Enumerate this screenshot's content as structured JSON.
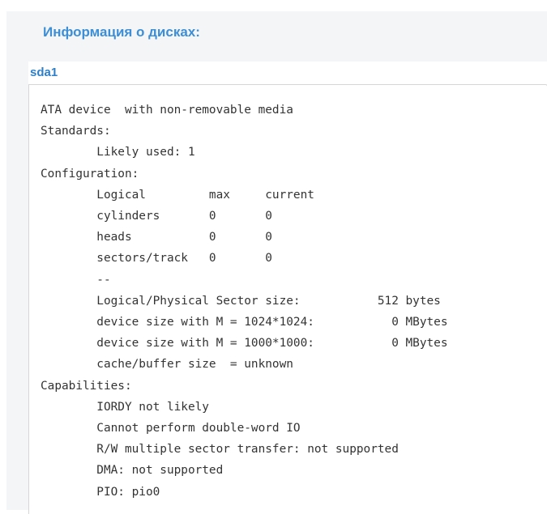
{
  "section": {
    "title": "Информация о дисках:"
  },
  "disks": [
    {
      "name": "sda1",
      "info_lines": [
        "ATA device  with non-removable media",
        "Standards:",
        "        Likely used: 1",
        "Configuration:",
        "        Logical         max     current",
        "        cylinders       0       0",
        "        heads           0       0",
        "        sectors/track   0       0",
        "        --",
        "        Logical/Physical Sector size:           512 bytes",
        "        device size with M = 1024*1024:           0 MBytes",
        "        device size with M = 1000*1000:           0 MBytes",
        "        cache/buffer size  = unknown",
        "Capabilities:",
        "        IORDY not likely",
        "        Cannot perform double-word IO",
        "        R/W multiple sector transfer: not supported",
        "        DMA: not supported",
        "        PIO: pio0"
      ]
    }
  ]
}
